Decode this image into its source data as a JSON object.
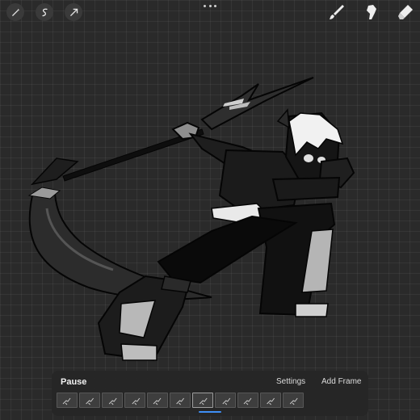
{
  "toolbar": {
    "left_icons": [
      "magic-wand-icon",
      "selection-s-icon",
      "transform-arrow-icon"
    ],
    "right_icons": [
      "brush-icon",
      "smudge-icon",
      "eraser-icon"
    ]
  },
  "animation_panel": {
    "title": "Pause",
    "settings_label": "Settings",
    "add_frame_label": "Add Frame",
    "frame_count": 11,
    "active_frame": 6
  },
  "colors": {
    "canvas_bg": "#2a2a2a",
    "accent": "#3f8ff5"
  }
}
